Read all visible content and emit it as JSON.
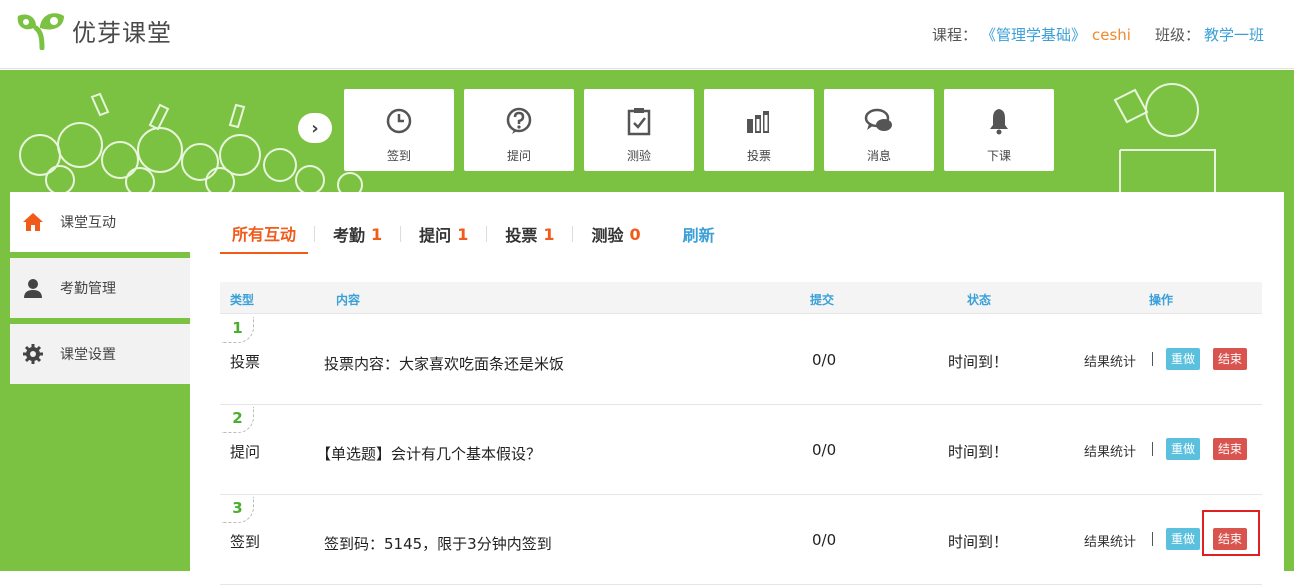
{
  "header": {
    "app_name": "优芽课堂",
    "course_label": "课程：",
    "course_name": "《管理学基础》",
    "course_user": "ceshi",
    "class_label": "班级：",
    "class_name": "教学一班"
  },
  "toolbar": {
    "expand_icon": "chevron-right-icon",
    "items": [
      {
        "label": "签到",
        "icon": "clock-icon"
      },
      {
        "label": "提问",
        "icon": "question-icon"
      },
      {
        "label": "测验",
        "icon": "clipboard-check-icon"
      },
      {
        "label": "投票",
        "icon": "bar-chart-icon"
      },
      {
        "label": "消息",
        "icon": "chat-bubbles-icon"
      },
      {
        "label": "下课",
        "icon": "bell-icon"
      }
    ]
  },
  "sidebar": {
    "items": [
      {
        "label": "课堂互动",
        "icon": "home-icon",
        "active": true
      },
      {
        "label": "考勤管理",
        "icon": "user-icon",
        "active": false
      },
      {
        "label": "课堂设置",
        "icon": "gear-icon",
        "active": false
      }
    ]
  },
  "tabs": [
    {
      "label": "所有互动",
      "count": "",
      "active": true
    },
    {
      "label": "考勤",
      "count": "1"
    },
    {
      "label": "提问",
      "count": "1"
    },
    {
      "label": "投票",
      "count": "1"
    },
    {
      "label": "测验",
      "count": "0"
    }
  ],
  "refresh_label": "刷新",
  "table": {
    "headers": [
      "类型",
      "内容",
      "提交",
      "状态",
      "操作"
    ],
    "rows": [
      {
        "num": "1",
        "type": "投票",
        "content": "投票内容：大家喜欢吃面条还是米饭",
        "submit": "0/0",
        "status": "时间到！",
        "stats": "结果统计",
        "redo": "重做",
        "end": "结束"
      },
      {
        "num": "2",
        "type": "提问",
        "content": "【单选题】会计有几个基本假设？",
        "submit": "0/0",
        "status": "时间到！",
        "stats": "结果统计",
        "redo": "重做",
        "end": "结束"
      },
      {
        "num": "3",
        "type": "签到",
        "content": "签到码：5145，限于3分钟内签到",
        "submit": "0/0",
        "status": "时间到！",
        "stats": "结果统计",
        "redo": "重做",
        "end": "结束"
      }
    ]
  },
  "colors": {
    "brand_green": "#7cc242",
    "accent_orange": "#f25a19",
    "link_blue": "#3ba0d8",
    "redo_blue": "#5bc0de",
    "end_red": "#d9534f"
  }
}
